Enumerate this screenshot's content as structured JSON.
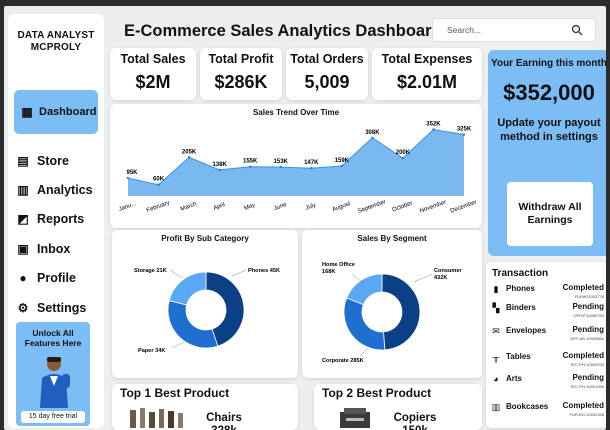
{
  "sidebar": {
    "brand_line1": "DATA ANALYST",
    "brand_line2": "MCPROLY",
    "items": [
      {
        "label": "Dashboard",
        "icon": "dashboard-icon"
      },
      {
        "label": "Store",
        "icon": "store-icon"
      },
      {
        "label": "Analytics",
        "icon": "analytics-icon"
      },
      {
        "label": "Reports",
        "icon": "reports-icon"
      },
      {
        "label": "Inbox",
        "icon": "inbox-icon"
      },
      {
        "label": "Profile",
        "icon": "profile-icon"
      },
      {
        "label": "Settings",
        "icon": "gear-icon"
      }
    ],
    "promo_title": "Unlock All Features Here",
    "promo_trial": "15 day free trial"
  },
  "header": {
    "title": "E-Commerce Sales Analytics Dashboard",
    "search_placeholder": "Search..."
  },
  "kpis": [
    {
      "label": "Total Sales",
      "value": "$2M"
    },
    {
      "label": "Total Profit",
      "value": "$286K"
    },
    {
      "label": "Total Orders",
      "value": "5,009"
    },
    {
      "label": "Total Expenses",
      "value": "$2.01M"
    }
  ],
  "earning": {
    "title": "Your Earning this month",
    "value": "$352,000",
    "message": "Update your payout method in settings",
    "withdraw_label": "Withdraw All Earnings"
  },
  "colors": {
    "accent": "#7dbdf5",
    "area_fill": "#7ab8f0",
    "donut_dark": "#0b3f86",
    "donut_mid": "#1e6fd0",
    "donut_light": "#5aa8f3"
  },
  "chart_data": [
    {
      "type": "area",
      "title": "Sales Trend Over Time",
      "categories": [
        "January",
        "February",
        "March",
        "April",
        "May",
        "June",
        "July",
        "August",
        "September",
        "October",
        "November",
        "December"
      ],
      "tick_labels": [
        "Janu...",
        "February",
        "March",
        "April",
        "May",
        "June",
        "July",
        "August",
        "September",
        "October",
        "November",
        "December"
      ],
      "values": [
        95,
        60,
        205,
        138,
        155,
        153,
        147,
        159,
        308,
        200,
        352,
        325
      ],
      "data_labels": [
        "95K",
        "60K",
        "205K",
        "138K",
        "155K",
        "153K",
        "147K",
        "159K",
        "308K",
        "200K",
        "352K",
        "325K"
      ],
      "ylim": [
        0,
        360
      ]
    },
    {
      "type": "pie",
      "title": "Profit By Sub Category",
      "categories": [
        "Phones",
        "Paper",
        "Storage"
      ],
      "values": [
        45,
        34,
        21
      ],
      "data_labels": [
        "Phones 45K",
        "Paper 34K",
        "Storage 21K"
      ]
    },
    {
      "type": "pie",
      "title": "Sales By Segment",
      "categories": [
        "Consumer",
        "Corporate",
        "Home Office"
      ],
      "values": [
        432,
        285,
        168
      ],
      "data_labels": [
        "Consumer 432K",
        "Corporate 285K",
        "Home Office 168K"
      ]
    }
  ],
  "transactions": {
    "title": "Transaction",
    "rows": [
      {
        "icon": "phone-icon",
        "name": "Phones",
        "status": "Completed",
        "id": "FUR8O1003778"
      },
      {
        "icon": "binders-icon",
        "name": "Binders",
        "status": "Pending",
        "id": "OFF8T10050763"
      },
      {
        "icon": "envelope-icon",
        "name": "Envelopes",
        "status": "Pending",
        "id": "OFF-AR-10003853"
      },
      {
        "icon": "table-icon",
        "name": "Tables",
        "status": "Completed",
        "id": "TEC-PH-10002033"
      },
      {
        "icon": "arts-icon",
        "name": "Arts",
        "status": "Pending",
        "id": "TEC-PH-10001949"
      },
      {
        "icon": "bookcase-icon",
        "name": "Bookcases",
        "status": "Completed",
        "id": "FUR-BO-10002348"
      }
    ]
  },
  "products": [
    {
      "label": "Top 1 Best Product",
      "name": "Chairs",
      "value": "328k"
    },
    {
      "label": "Top 2 Best Product",
      "name": "Copiers",
      "value": "150k"
    }
  ]
}
